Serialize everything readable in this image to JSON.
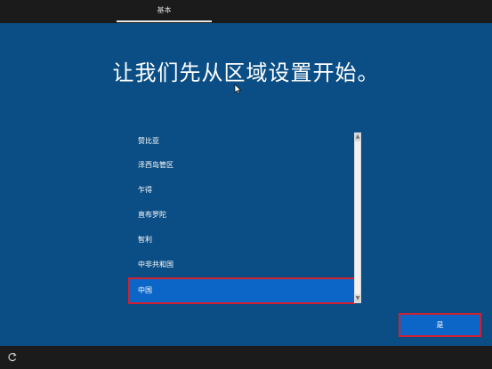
{
  "header": {
    "tab_label": "基本"
  },
  "main": {
    "heading": "让我们先从区域设置开始。",
    "region_list": [
      {
        "label": "赞比亚",
        "selected": false
      },
      {
        "label": "泽西岛管区",
        "selected": false
      },
      {
        "label": "乍得",
        "selected": false
      },
      {
        "label": "直布罗陀",
        "selected": false
      },
      {
        "label": "智利",
        "selected": false
      },
      {
        "label": "中非共和国",
        "selected": false
      },
      {
        "label": "中国",
        "selected": true
      }
    ]
  },
  "footer": {
    "yes_button_label": "是",
    "accessibility_icon": "ease-of-access-icon"
  },
  "colors": {
    "background": "#0b4e85",
    "bar": "#1b1b1b",
    "selection": "#0b66c7",
    "highlight_border": "#d2202f"
  }
}
